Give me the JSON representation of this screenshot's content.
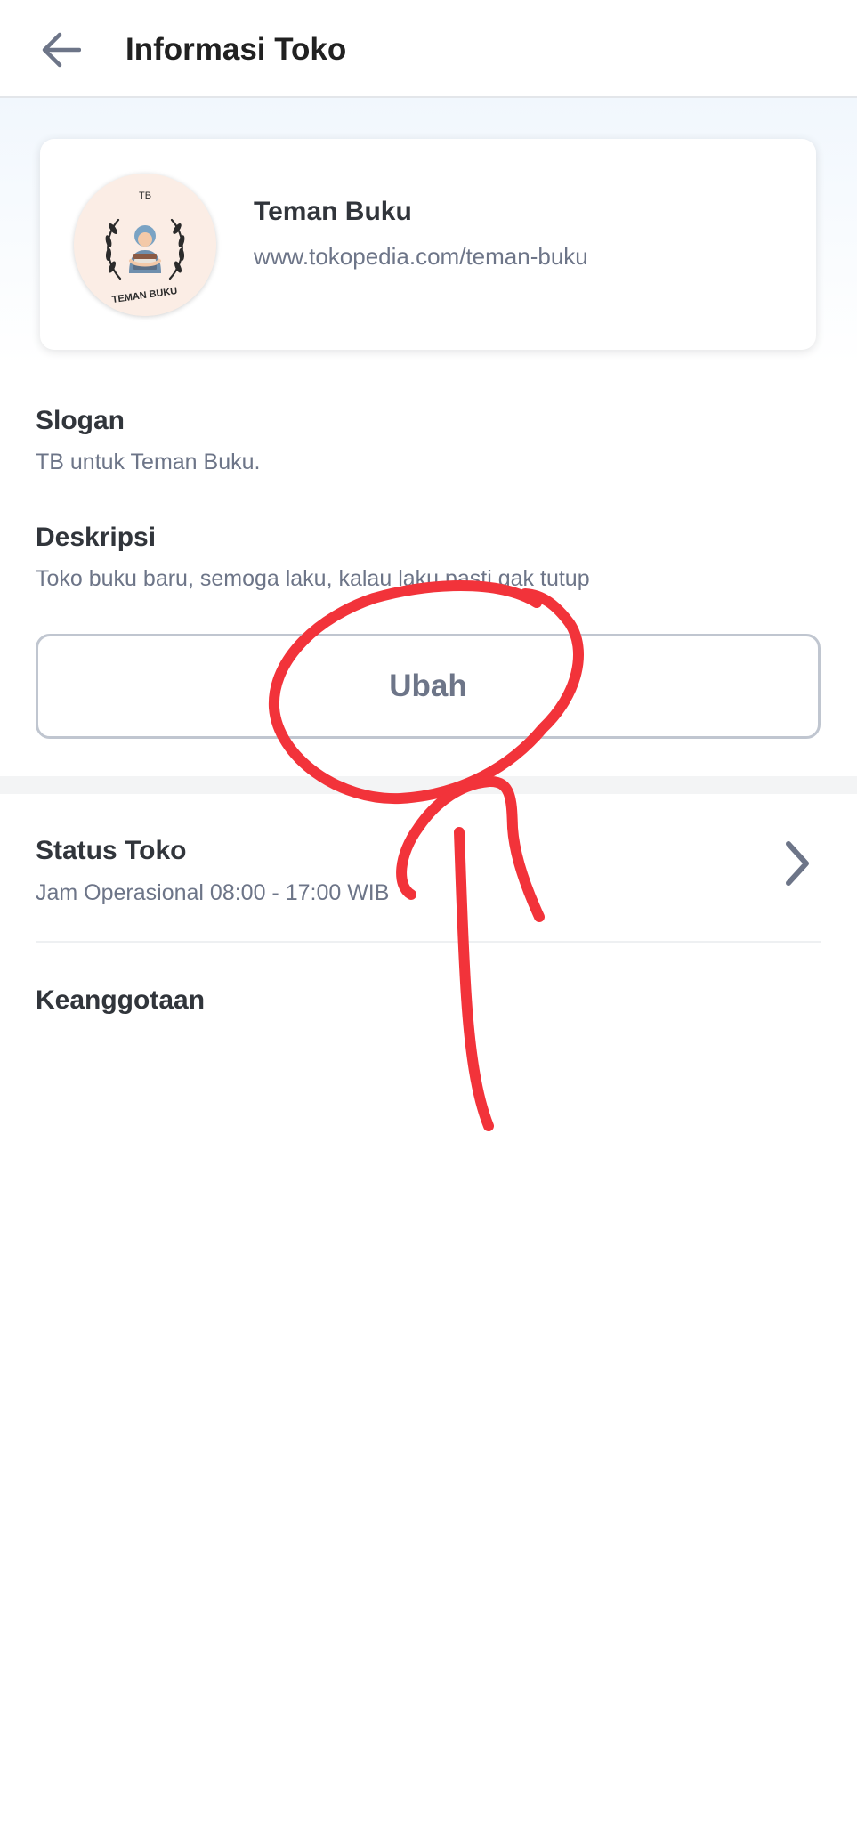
{
  "header": {
    "title": "Informasi Toko",
    "back_icon": "arrow-left-icon"
  },
  "shop": {
    "name": "Teman Buku",
    "url": "www.tokopedia.com/teman-buku",
    "logo_text_top": "TB",
    "logo_text_bottom": "TEMAN BUKU"
  },
  "slogan": {
    "label": "Slogan",
    "value": "TB untuk Teman Buku."
  },
  "deskripsi": {
    "label": "Deskripsi",
    "value": "Toko buku baru, semoga laku, kalau laku pasti gak tutup"
  },
  "edit_button": {
    "label": "Ubah"
  },
  "status_toko": {
    "label": "Status Toko",
    "value": "Jam Operasional 08:00 - 17:00 WIB",
    "icon": "chevron-right-icon"
  },
  "keanggotaan": {
    "label": "Keanggotaan"
  },
  "colors": {
    "annotation": "#f2333a",
    "text_primary": "#31353b",
    "text_secondary": "#6d7588",
    "button_border": "#c0c6d0"
  }
}
